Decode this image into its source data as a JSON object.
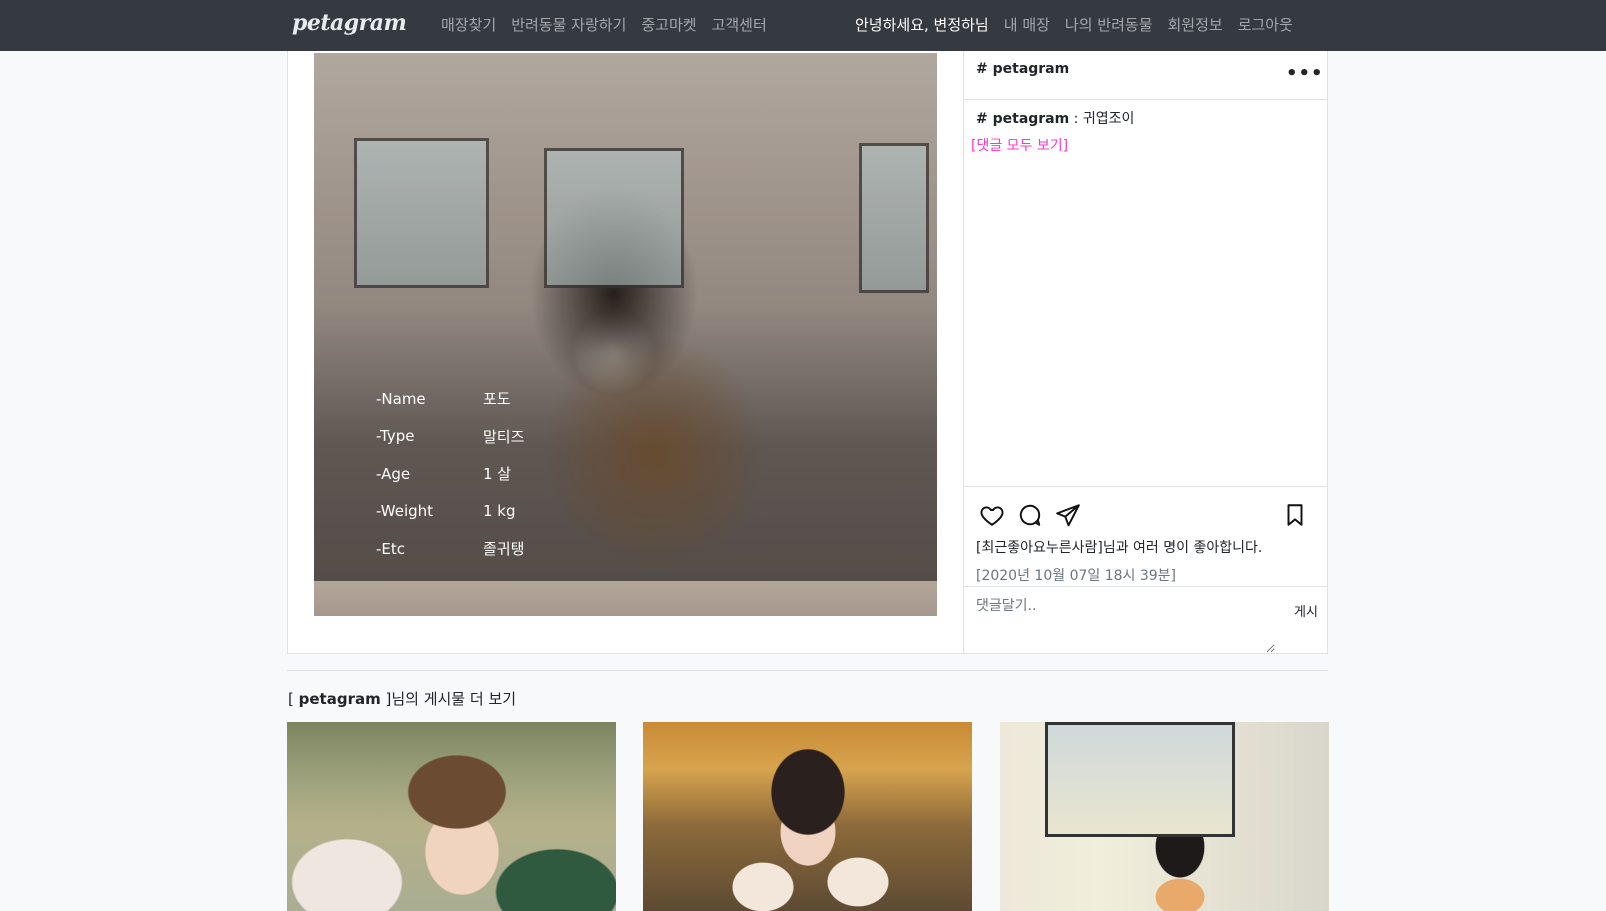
{
  "navbar": {
    "brand": "petagram",
    "left_links": [
      "매장찾기",
      "반려동물 자랑하기",
      "중고마켓",
      "고객센터"
    ],
    "greeting": "안녕하세요, 변정하님",
    "right_links": [
      "내 매장",
      "나의 반려동물",
      "회원정보",
      "로그아웃"
    ]
  },
  "pet_info": [
    {
      "key": "-Name",
      "value": "포도"
    },
    {
      "key": "-Type",
      "value": "말티즈"
    },
    {
      "key": "-Age",
      "value": "1 살"
    },
    {
      "key": "-Weight",
      "value": "1 kg"
    },
    {
      "key": "-Etc",
      "value": "졸귀탱"
    }
  ],
  "post": {
    "header_user": "# petagram",
    "more_icon": "•••",
    "caption_user": "# petagram",
    "caption_sep": " : ",
    "caption_text": "귀엽조이",
    "view_all_comments": "[댓글 모두 보기]",
    "likes_text": "[최근좋아요누른사람]님과 여러 명이 좋아합니다.",
    "date_text": "[2020년 10월 07일 18시 39분]",
    "comment_placeholder": "댓글달기..",
    "post_button": "게시",
    "icons": [
      "heart-icon",
      "comment-icon",
      "send-icon",
      "bookmark-icon"
    ]
  },
  "more_posts": {
    "prefix": "[ ",
    "user": "petagram",
    "suffix": " ]님의 게시물 더 보기"
  },
  "colors": {
    "navbar_bg": "#343a40",
    "link_pink": "#ff33cc"
  }
}
